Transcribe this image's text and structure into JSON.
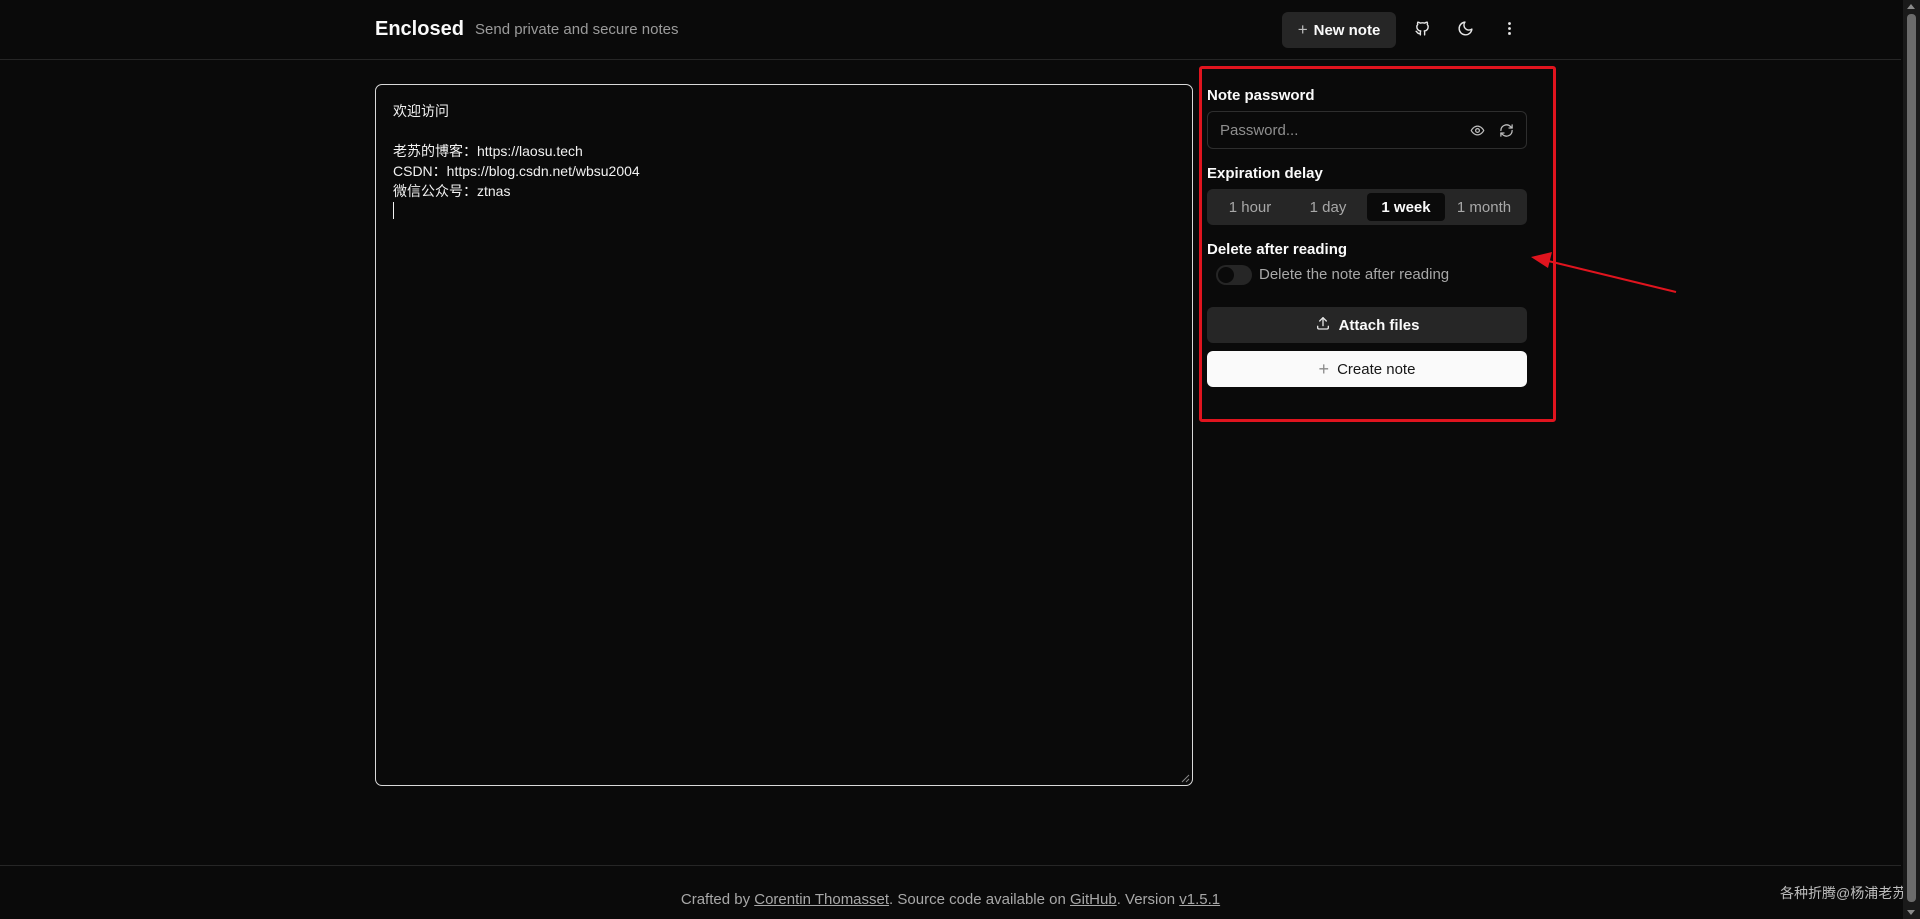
{
  "header": {
    "brand": "Enclosed",
    "tagline": "Send private and secure notes",
    "new_note_label": "New note",
    "icons": [
      "github-icon",
      "moon-icon",
      "more-vertical-icon"
    ]
  },
  "editor": {
    "lines": [
      "欢迎访问",
      "",
      "老苏的博客：https://laosu.tech",
      "CSDN：https://blog.csdn.net/wbsu2004",
      "微信公众号：ztnas"
    ]
  },
  "settings": {
    "password_label": "Note password",
    "password_placeholder": "Password...",
    "expiration_label": "Expiration delay",
    "expiration_options": [
      "1 hour",
      "1 day",
      "1 week",
      "1 month"
    ],
    "expiration_selected": "1 week",
    "delete_label": "Delete after reading",
    "delete_toggle_label": "Delete the note after reading",
    "delete_enabled": false,
    "attach_label": "Attach files",
    "create_label": "Create note"
  },
  "annotation": {
    "highlight_color": "#e0141e"
  },
  "footer": {
    "prefix": "Crafted by ",
    "author": "Corentin Thomasset",
    "middle": ". Source code available on ",
    "source_link": "GitHub",
    "version_prefix": ". Version ",
    "version": "v1.5.1"
  },
  "watermark": "各种折腾@杨浦老苏",
  "colors": {
    "background": "#0a0a0a",
    "surface": "#262626",
    "text": "#fafafa",
    "muted": "#a8a8a8"
  }
}
